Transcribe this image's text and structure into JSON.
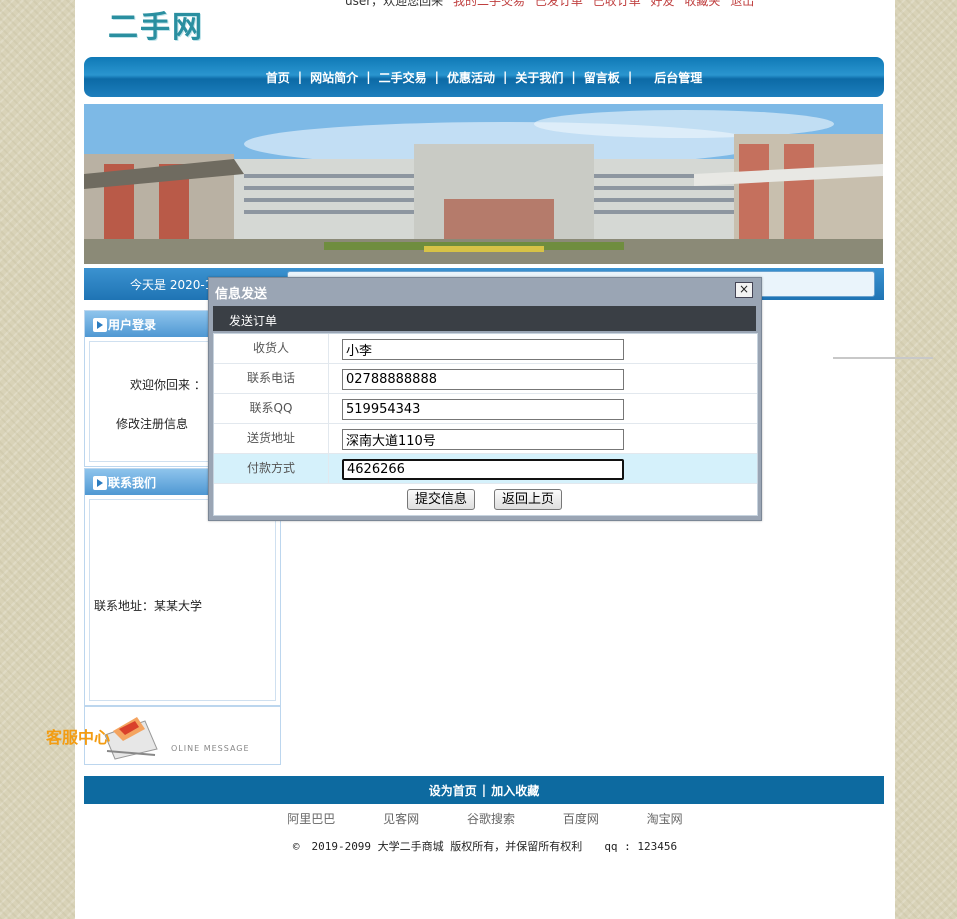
{
  "header": {
    "logo": "二手网",
    "topline": {
      "welcome": "user，欢迎您回来",
      "links": [
        "我的二手交易",
        "已发订单",
        "已收订单",
        "好友",
        "收藏夹",
        "退出"
      ]
    }
  },
  "nav": {
    "items": [
      "首页",
      "网站简介",
      "二手交易",
      "优惠活动",
      "关于我们",
      "留言板",
      "后台管理"
    ]
  },
  "datebar": {
    "date": "今天是 2020-1"
  },
  "sidebar": {
    "login": {
      "title": "用户登录",
      "welcome": "欢迎你回来 ：",
      "modify": "修改注册信息"
    },
    "contact": {
      "title": "联系我们",
      "address": "联系地址：某某大学"
    },
    "service_badge": "客服中心",
    "message_caption": "OLINE MESSAGE"
  },
  "dialog": {
    "title": "信息发送",
    "close": "×",
    "section": "发送订单",
    "fields": [
      {
        "label": "收货人",
        "value": "小李"
      },
      {
        "label": "联系电话",
        "value": "02788888888"
      },
      {
        "label": "联系QQ",
        "value": "519954343"
      },
      {
        "label": "送货地址",
        "value": "深南大道110号"
      },
      {
        "label": "付款方式",
        "value": "4626266"
      }
    ],
    "submit": "提交信息",
    "back": "返回上页"
  },
  "footer": {
    "bar": [
      "设为首页",
      "加入收藏"
    ],
    "bar_sep": "|",
    "links": [
      "阿里巴巴",
      "见客网",
      "谷歌搜索",
      "百度网",
      "淘宝网"
    ],
    "copyright_symbol": "©",
    "copyright": "2019-2099 大学二手商城 版权所有，并保留所有权利",
    "qq": "qq : 123456"
  }
}
